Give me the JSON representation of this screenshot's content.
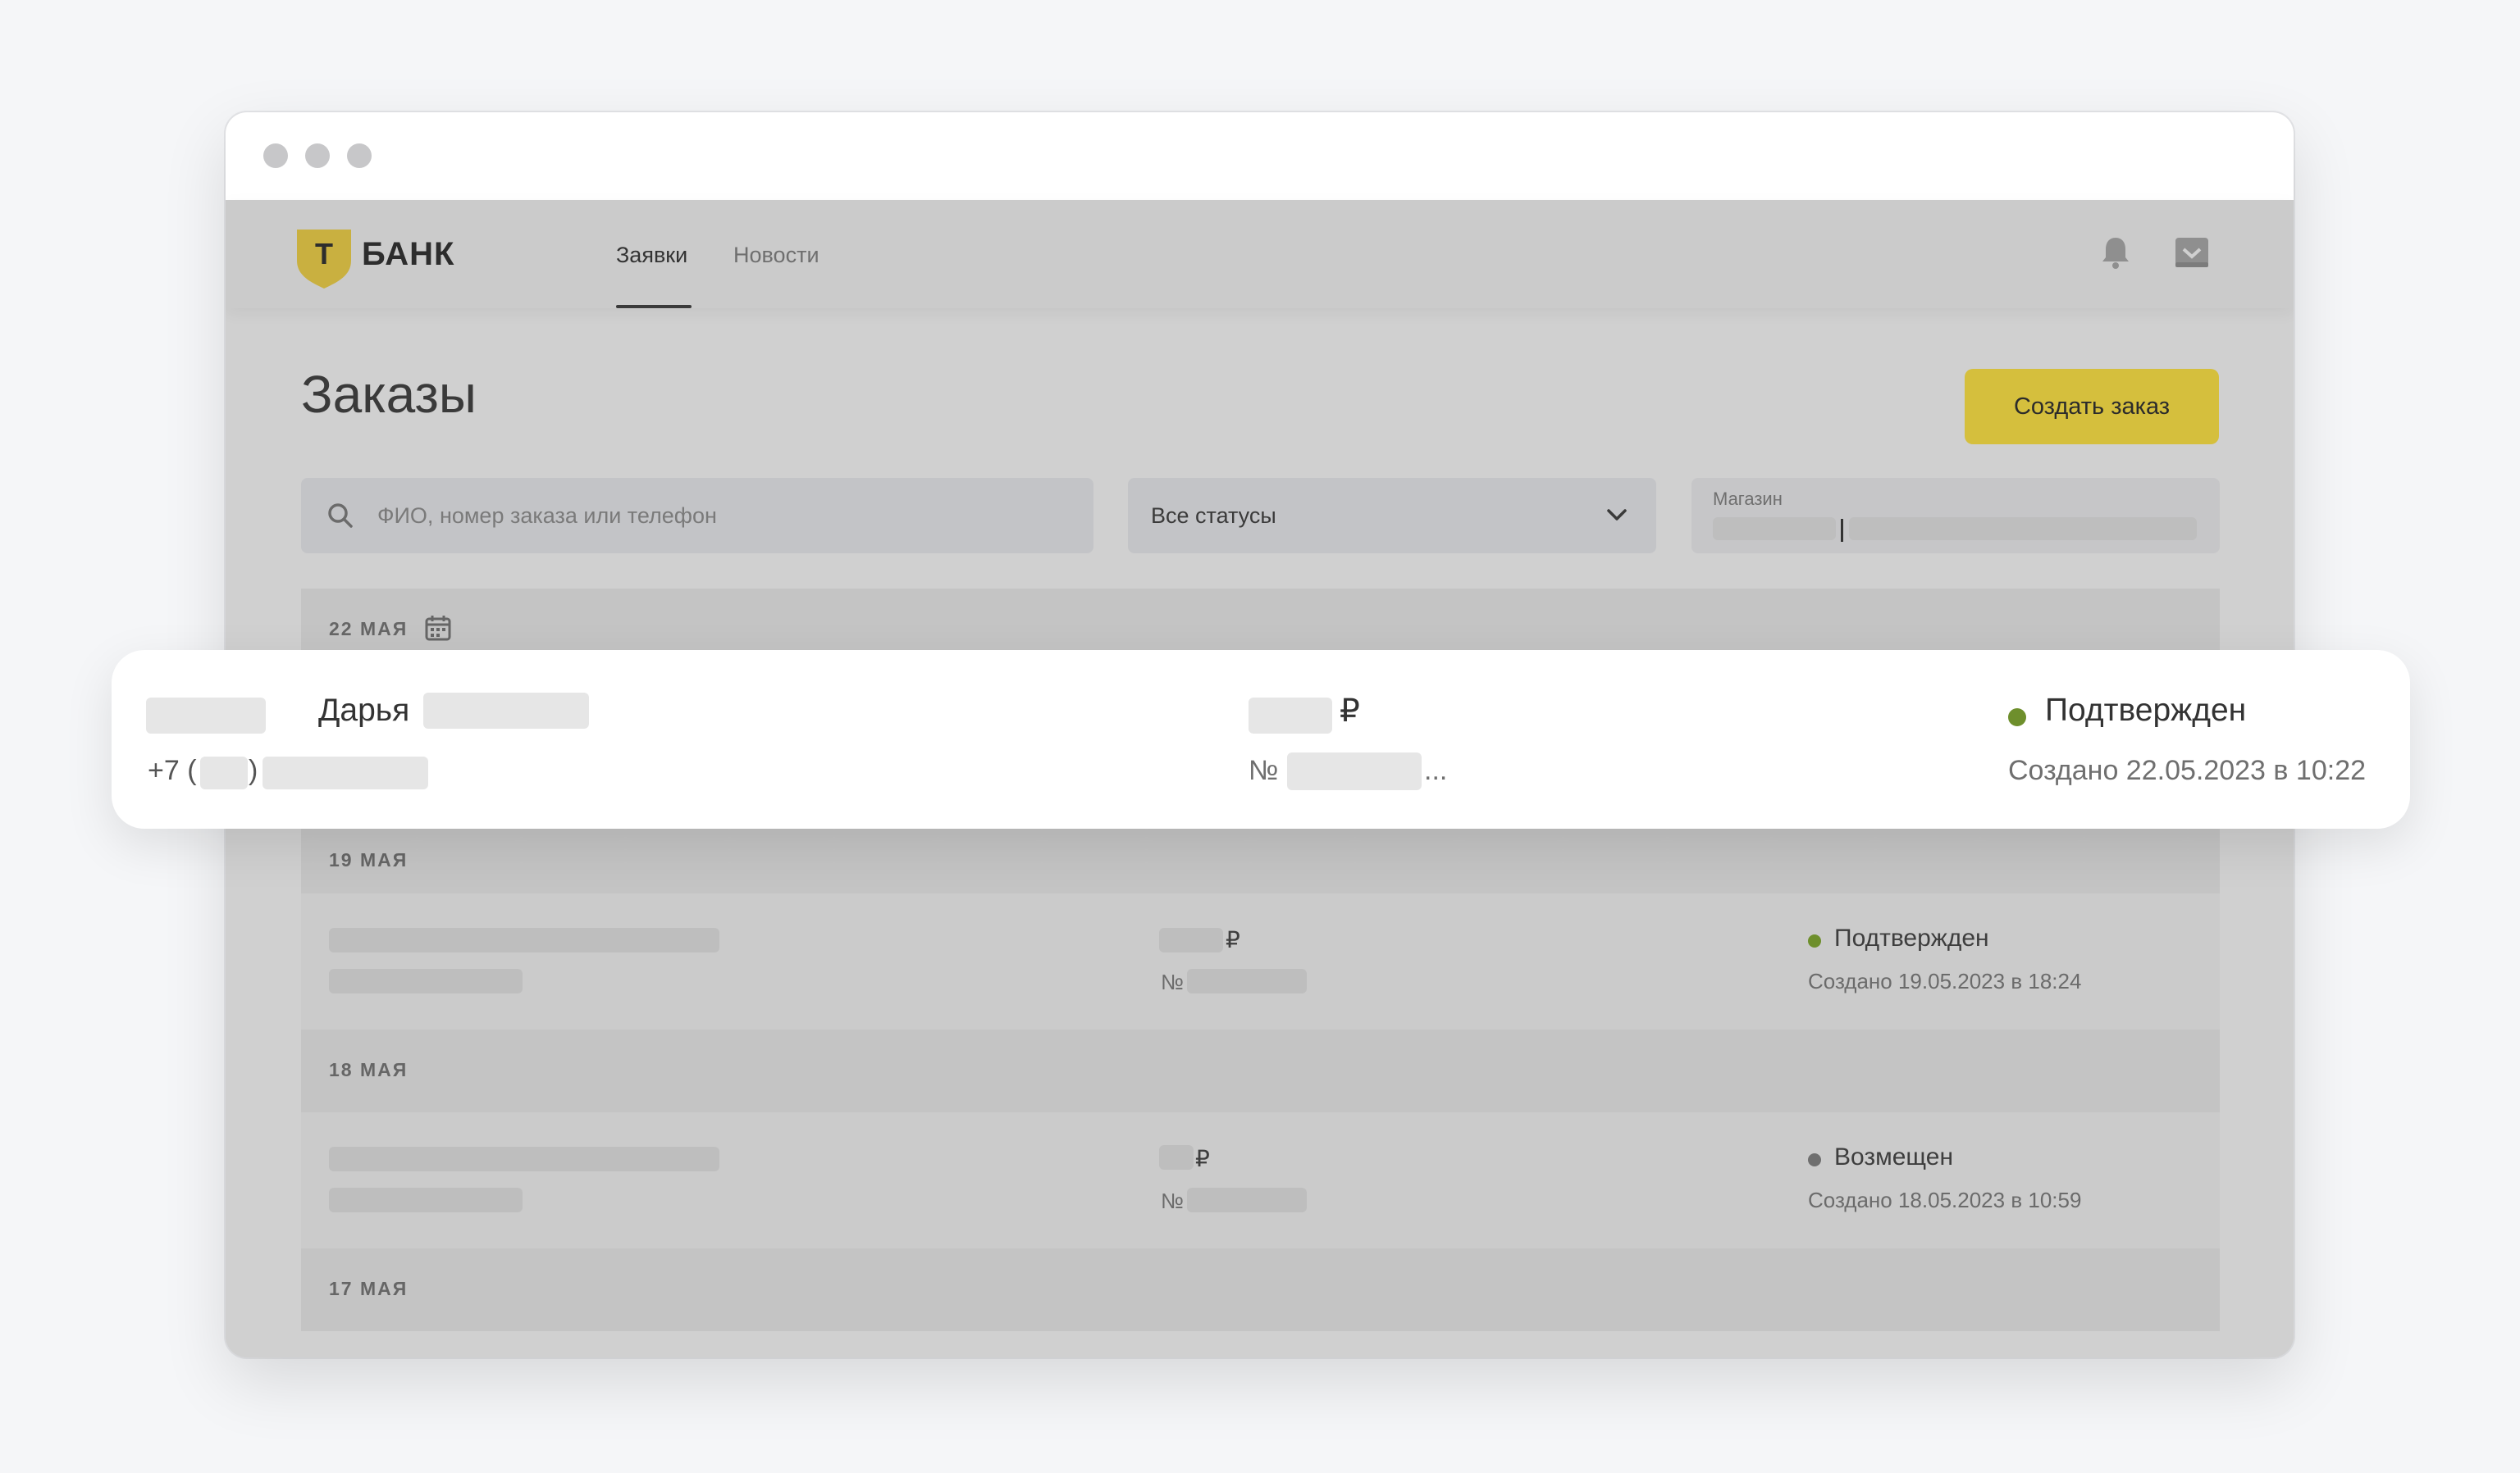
{
  "header": {
    "logo_text": "БАНК",
    "logo_letter": "Т",
    "nav": [
      {
        "label": "Заявки",
        "active": true
      },
      {
        "label": "Новости",
        "active": false
      }
    ],
    "icons": [
      "bell-icon",
      "inbox-icon"
    ]
  },
  "page": {
    "title": "Заказы",
    "create_button": "Создать заказ"
  },
  "filters": {
    "search_placeholder": "ФИО, номер заказа или телефон",
    "status_value": "Все статусы",
    "shop_label": "Магазин"
  },
  "highlighted_order": {
    "name": "Дарья",
    "phone_prefix": "+7 (",
    "phone_close": ")",
    "currency": "₽",
    "number_prefix": "№",
    "number_ellipsis": "...",
    "status": "Подтвержден",
    "created": "Создано 22.05.2023 в 10:22"
  },
  "groups": [
    {
      "date": "22 МАЯ"
    },
    {
      "date": "19 МАЯ"
    },
    {
      "date": "18 МАЯ"
    },
    {
      "date": "17 МАЯ"
    }
  ],
  "orders": [
    {
      "currency": "₽",
      "number_prefix": "№",
      "status": "Подтвержден",
      "created": "Создано 19.05.2023 в 18:24"
    },
    {
      "currency": "₽",
      "number_prefix": "№",
      "status": "Возмещен",
      "created": "Создано 18.05.2023 в 10:59"
    }
  ],
  "colors": {
    "accent": "#d5bf3d",
    "status_confirmed": "#6e8f2c",
    "status_refunded": "#6f6f6f",
    "logo_shield": "#e7c71d"
  }
}
